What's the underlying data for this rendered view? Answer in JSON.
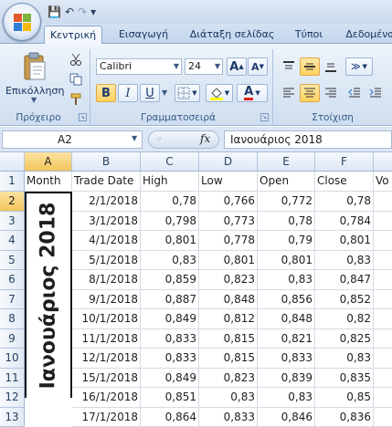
{
  "qat": {
    "save": "💾",
    "undo": "↶",
    "redo": "↷",
    "customize": "▾"
  },
  "tabs": [
    "Κεντρική",
    "Εισαγωγή",
    "Διάταξη σελίδας",
    "Τύποι",
    "Δεδομένα"
  ],
  "ribbon": {
    "paste_label": "Επικόλληση",
    "font_name": "Calibri",
    "font_size": "24",
    "bold": "B",
    "italic": "I",
    "underline": "U",
    "groups": {
      "clipboard": "Πρόχειρο",
      "font": "Γραμματοσειρά",
      "alignment": "Στοίχιση"
    }
  },
  "formula_bar": {
    "name_box": "A2",
    "fx": "fx",
    "content": "Ιανουάριος 2018"
  },
  "columns": [
    "A",
    "B",
    "C",
    "D",
    "E",
    "F"
  ],
  "header_row": [
    "Month",
    "Trade Date",
    "High",
    "Low",
    "Open",
    "Close",
    "Vo"
  ],
  "merged_cell": "Ιανουάριος 2018",
  "rows": [
    {
      "num": "2",
      "date": "2/1/2018",
      "high": "0,78",
      "low": "0,766",
      "open": "0,772",
      "close": "0,78"
    },
    {
      "num": "3",
      "date": "3/1/2018",
      "high": "0,798",
      "low": "0,773",
      "open": "0,78",
      "close": "0,784"
    },
    {
      "num": "4",
      "date": "4/1/2018",
      "high": "0,801",
      "low": "0,778",
      "open": "0,79",
      "close": "0,801"
    },
    {
      "num": "5",
      "date": "5/1/2018",
      "high": "0,83",
      "low": "0,801",
      "open": "0,801",
      "close": "0,83"
    },
    {
      "num": "6",
      "date": "8/1/2018",
      "high": "0,859",
      "low": "0,823",
      "open": "0,83",
      "close": "0,847"
    },
    {
      "num": "7",
      "date": "9/1/2018",
      "high": "0,887",
      "low": "0,848",
      "open": "0,856",
      "close": "0,852"
    },
    {
      "num": "8",
      "date": "10/1/2018",
      "high": "0,849",
      "low": "0,812",
      "open": "0,848",
      "close": "0,82"
    },
    {
      "num": "9",
      "date": "11/1/2018",
      "high": "0,833",
      "low": "0,815",
      "open": "0,821",
      "close": "0,825"
    },
    {
      "num": "10",
      "date": "12/1/2018",
      "high": "0,833",
      "low": "0,815",
      "open": "0,833",
      "close": "0,83"
    },
    {
      "num": "11",
      "date": "15/1/2018",
      "high": "0,849",
      "low": "0,823",
      "open": "0,839",
      "close": "0,835"
    },
    {
      "num": "12",
      "date": "16/1/2018",
      "high": "0,851",
      "low": "0,83",
      "open": "0,83",
      "close": "0,85"
    },
    {
      "num": "13",
      "date": "17/1/2018",
      "high": "0,864",
      "low": "0,833",
      "open": "0,846",
      "close": "0,836"
    }
  ],
  "colors": {
    "accent": "#f4c55a",
    "ribbon": "#dae6f4",
    "header_border": "#9db4d3"
  }
}
